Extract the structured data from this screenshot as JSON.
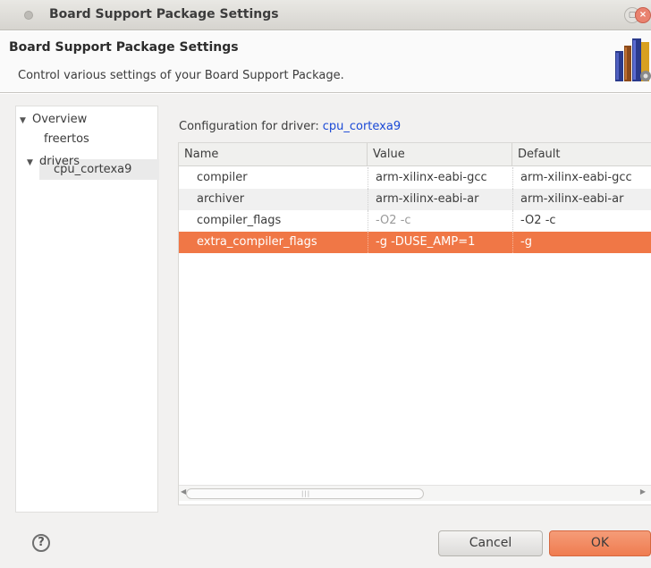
{
  "window": {
    "title": "Board Support Package Settings"
  },
  "header": {
    "title": "Board Support Package Settings",
    "description": "Control various settings of your Board Support Package."
  },
  "tree": {
    "items": [
      {
        "label": "Overview",
        "expanded": true,
        "arrow": "▼"
      },
      {
        "label": "freertos"
      },
      {
        "label": "drivers",
        "expanded": true,
        "arrow": "▼"
      },
      {
        "label": "cpu_cortexa9",
        "selected": true
      }
    ]
  },
  "config": {
    "label": "Configuration for driver:",
    "driver": "cpu_cortexa9"
  },
  "table": {
    "columns": [
      "Name",
      "Value",
      "Default"
    ],
    "rows": [
      {
        "name": "compiler",
        "value": "arm-xilinx-eabi-gcc",
        "default": "arm-xilinx-eabi-gcc"
      },
      {
        "name": "archiver",
        "value": "arm-xilinx-eabi-ar",
        "default": "arm-xilinx-eabi-ar"
      },
      {
        "name": "compiler_flags",
        "value": "-O2 -c",
        "default": "-O2 -c"
      },
      {
        "name": "extra_compiler_flags",
        "value": "-g -DUSE_AMP=1",
        "default": "-g",
        "selected": true
      }
    ]
  },
  "footer": {
    "help": "?",
    "cancel": "Cancel",
    "ok": "OK"
  },
  "colors": {
    "accent": "#f07746",
    "link": "#1a49d6"
  }
}
